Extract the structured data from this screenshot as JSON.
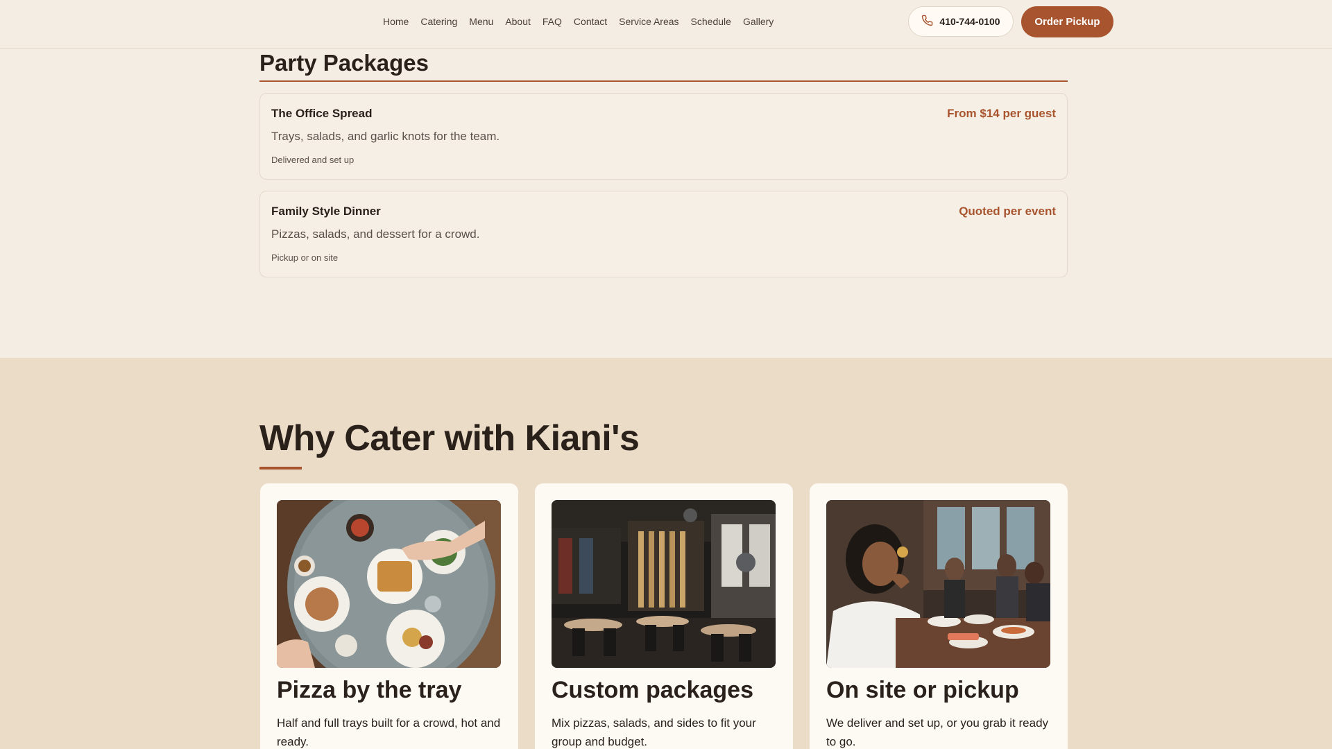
{
  "header": {
    "nav": [
      "Home",
      "Catering",
      "Menu",
      "About",
      "FAQ",
      "Contact",
      "Service Areas",
      "Schedule",
      "Gallery"
    ],
    "phone": "410-744-0100",
    "order_label": "Order Pickup"
  },
  "packages": {
    "title": "Party Packages",
    "items": [
      {
        "name": "The Office Spread",
        "price": "From $14 per guest",
        "description": "Trays, salads, and garlic knots for the team.",
        "note": "Delivered and set up"
      },
      {
        "name": "Family Style Dinner",
        "price": "Quoted per event",
        "description": "Pizzas, salads, and dessert for a crowd.",
        "note": "Pickup or on site"
      }
    ]
  },
  "why": {
    "title": "Why Cater with Kiani's",
    "features": [
      {
        "title": "Pizza by the tray",
        "text": "Half and full trays built for a crowd, hot and ready."
      },
      {
        "title": "Custom packages",
        "text": "Mix pizzas, salads, and sides to fit your group and budget."
      },
      {
        "title": "On site or pickup",
        "text": "We deliver and set up, or you grab it ready to go."
      }
    ]
  },
  "colors": {
    "accent": "#a8542e",
    "page_bg": "#f4ede3",
    "section_bg": "#ebdcc8",
    "card_bg": "#fdf9f3"
  },
  "icons": {
    "phone": "phone-icon"
  }
}
